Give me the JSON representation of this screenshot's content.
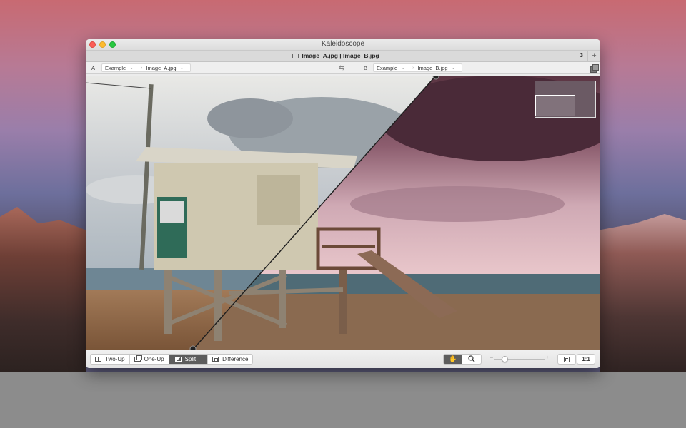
{
  "window": {
    "app_title": "Kaleidoscope"
  },
  "tabbar": {
    "title": "Image_A.jpg | Image_B.jpg",
    "count": "3",
    "add_label": "+"
  },
  "pathbar": {
    "left": {
      "side": "A",
      "folder": "Example",
      "file": "Image_A.jpg"
    },
    "right": {
      "side": "B",
      "folder": "Example",
      "file": "Image_B.jpg"
    },
    "swap_icon": "⇆"
  },
  "toolbar": {
    "modes": [
      {
        "label": "Two-Up",
        "icon": "two-up-icon",
        "active": false
      },
      {
        "label": "One-Up",
        "icon": "one-up-icon",
        "active": false
      },
      {
        "label": "Split",
        "icon": "split-icon",
        "active": true
      },
      {
        "label": "Difference",
        "icon": "difference-icon",
        "active": false
      }
    ],
    "hand_tool": "✋",
    "zoom_tool": "🔍",
    "zoom_level": 0.2,
    "zoom_minus": "–",
    "zoom_plus": "+",
    "actual_size_label": "1:1"
  },
  "colors": {
    "window_bg": "#ececec",
    "active_segment": "#5d5d5d"
  }
}
